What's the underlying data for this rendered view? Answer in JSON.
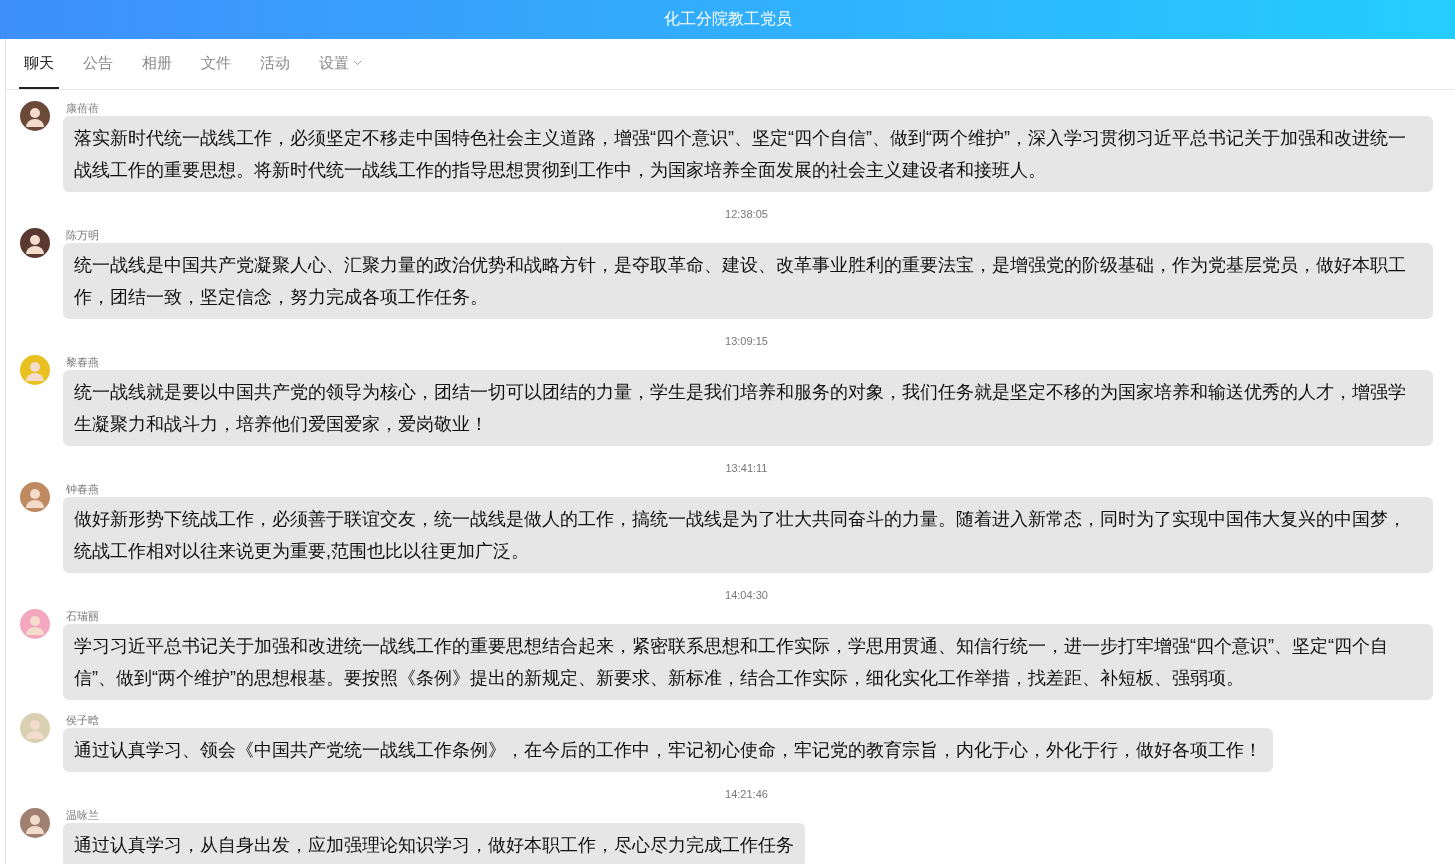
{
  "window": {
    "title": "化工分院教工党员"
  },
  "tabs": [
    {
      "label": "聊天",
      "selected": true,
      "dropdown": false
    },
    {
      "label": "公告",
      "selected": false,
      "dropdown": false
    },
    {
      "label": "相册",
      "selected": false,
      "dropdown": false
    },
    {
      "label": "文件",
      "selected": false,
      "dropdown": false
    },
    {
      "label": "活动",
      "selected": false,
      "dropdown": false
    },
    {
      "label": "设置",
      "selected": false,
      "dropdown": true
    }
  ],
  "feed": [
    {
      "kind": "message",
      "name": "康蓓蓓",
      "text": "落实新时代统一战线工作，必须坚定不移走中国特色社会主义道路，增强“四个意识”、坚定“四个自信”、做到“两个维护”，深入学习贯彻习近平总书记关于加强和改进统一战线工作的重要思想。将新时代统一战线工作的指导思想贯彻到工作中，为国家培养全面发展的社会主义建设者和接班人。"
    },
    {
      "kind": "time",
      "text": "12:38:05"
    },
    {
      "kind": "message",
      "name": "陈万明",
      "text": "统一战线是中国共产党凝聚人心、汇聚力量的政治优势和战略方针，是夺取革命、建设、改革事业胜利的重要法宝，是增强党的阶级基础，作为党基层党员，做好本职工作，团结一致，坚定信念，努力完成各项工作任务。"
    },
    {
      "kind": "time",
      "text": "13:09:15"
    },
    {
      "kind": "message",
      "name": "黎春燕",
      "text": "统一战线就是要以中国共产党的领导为核心，团结一切可以团结的力量，学生是我们培养和服务的对象，我们任务就是坚定不移的为国家培养和输送优秀的人才，增强学生凝聚力和战斗力，培养他们爱国爱家，爱岗敬业！"
    },
    {
      "kind": "time",
      "text": "13:41:11"
    },
    {
      "kind": "message",
      "name": "钟春燕",
      "text": "做好新形势下统战工作，必须善于联谊交友，统一战线是做人的工作，搞统一战线是为了壮大共同奋斗的力量。随着进入新常态，同时为了实现中国伟大复兴的中国梦，统战工作相对以往来说更为重要,范围也比以往更加广泛。"
    },
    {
      "kind": "time",
      "text": "14:04:30"
    },
    {
      "kind": "message",
      "name": "石瑞丽",
      "text": "学习习近平总书记关于加强和改进统一战线工作的重要思想结合起来，紧密联系思想和工作实际，学思用贯通、知信行统一，进一步打牢增强“四个意识”、坚定“四个自信”、做到“两个维护”的思想根基。要按照《条例》提出的新规定、新要求、新标准，结合工作实际，细化实化工作举措，找差距、补短板、强弱项。"
    },
    {
      "kind": "message",
      "name": "侯子晗",
      "text": "通过认真学习、领会《中国共产党统一战线工作条例》，在今后的工作中，牢记初心使命，牢记党的教育宗旨，内化于心，外化于行，做好各项工作！"
    },
    {
      "kind": "time",
      "text": "14:21:46"
    },
    {
      "kind": "message",
      "name": "温咏兰",
      "text": "通过认真学习，从自身出发，应加强理论知识学习，做好本职工作，尽心尽力完成工作任务"
    }
  ]
}
